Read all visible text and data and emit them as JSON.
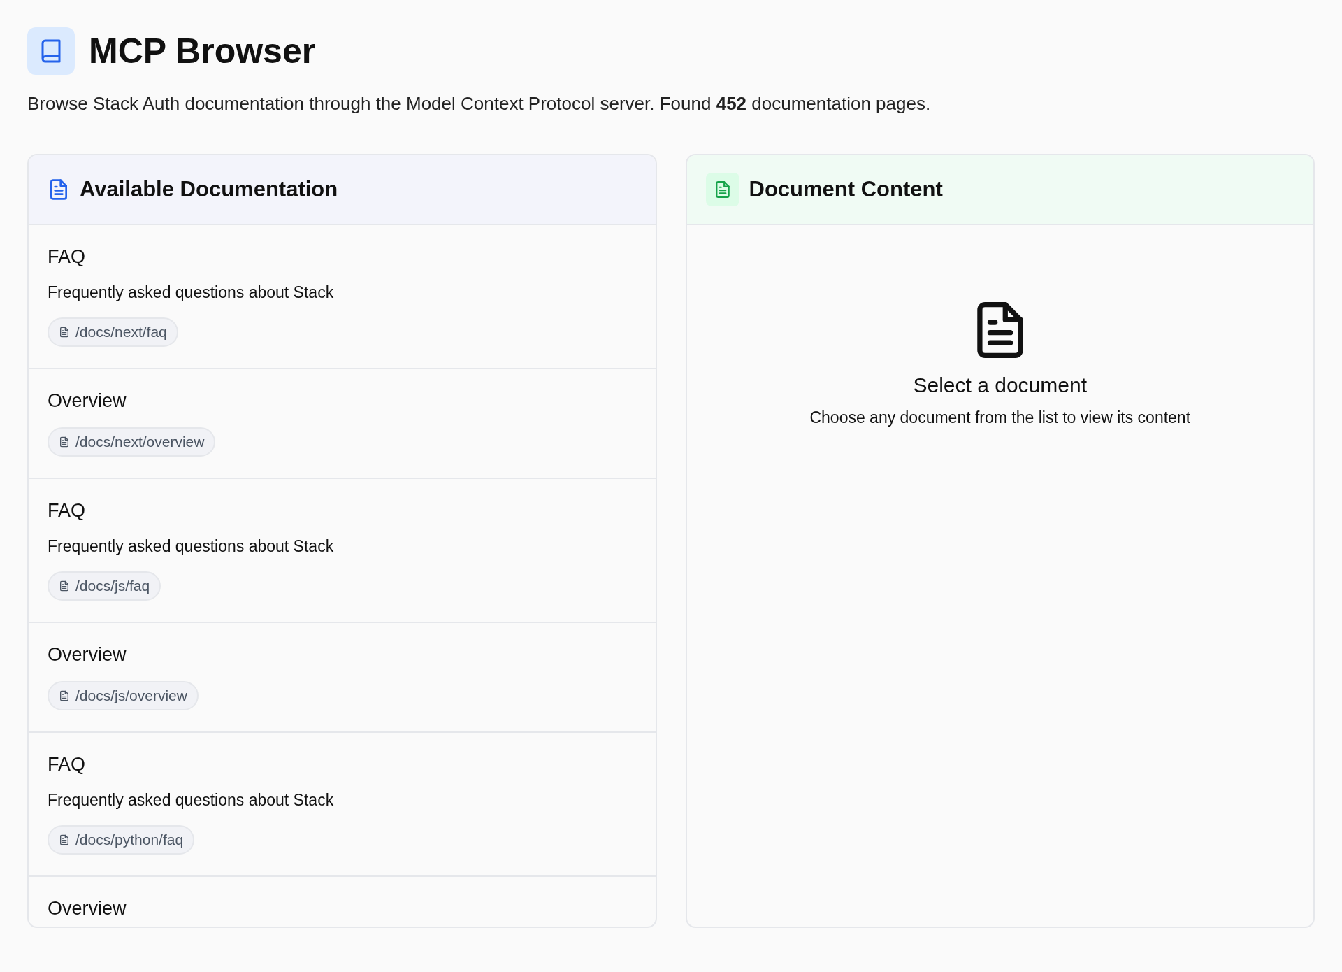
{
  "header": {
    "title": "MCP Browser",
    "description": "Browse Stack Auth documentation through the Model Context Protocol server. Found **452** documentation pages."
  },
  "docs_panel": {
    "title": "Available Documentation",
    "items": [
      {
        "title": "FAQ",
        "description": "Frequently asked questions about Stack",
        "path": "/docs/next/faq"
      },
      {
        "title": "Overview",
        "path": "/docs/next/overview"
      },
      {
        "title": "FAQ",
        "description": "Frequently asked questions about Stack",
        "path": "/docs/js/faq"
      },
      {
        "title": "Overview",
        "path": "/docs/js/overview"
      },
      {
        "title": "FAQ",
        "description": "Frequently asked questions about Stack",
        "path": "/docs/python/faq"
      },
      {
        "title": "Overview"
      }
    ]
  },
  "content_panel": {
    "title": "Document Content",
    "empty_title": "Select a document",
    "empty_text": "Choose any document from the list to view its content"
  }
}
